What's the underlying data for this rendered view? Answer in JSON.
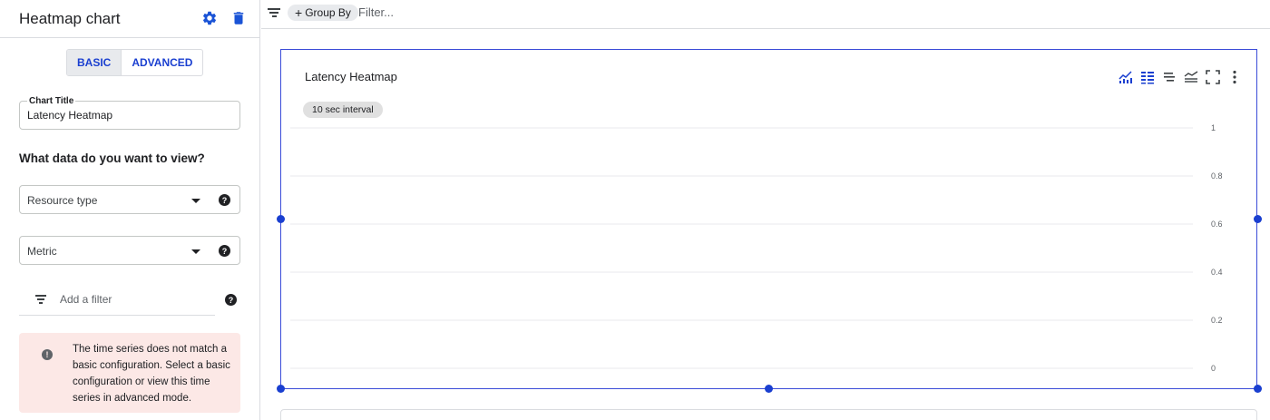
{
  "panel": {
    "title": "Heatmap chart",
    "settings_icon": "gear-icon",
    "delete_icon": "trash-icon",
    "modes": [
      "BASIC",
      "ADVANCED"
    ],
    "active_mode": "BASIC",
    "chart_title_label": "Chart Title",
    "chart_title_value": "Latency Heatmap",
    "data_question": "What data do you want to view?",
    "resource_type_label": "Resource type",
    "metric_label": "Metric",
    "add_filter_label": "Add a filter",
    "warning_text": "The time series does not match a basic configuration. Select a basic configuration or view this time series in advanced mode."
  },
  "topbar": {
    "group_by_label": "Group By",
    "filter_placeholder": "Filter..."
  },
  "chart": {
    "title": "Latency Heatmap",
    "interval_label": "10 sec interval",
    "toolbar_icons": [
      "line-chart-icon",
      "legend-icon",
      "sort-icon",
      "compare-icon",
      "fullscreen-icon",
      "more-vert-icon"
    ],
    "accent_color": "#1a3fd0"
  },
  "chart_data": {
    "type": "heatmap",
    "title": "Latency Heatmap",
    "ylim": [
      0,
      1
    ],
    "y_ticks": [
      "0",
      "0.2",
      "0.4",
      "0.6",
      "0.8",
      "1"
    ],
    "series": [],
    "grid": true
  }
}
